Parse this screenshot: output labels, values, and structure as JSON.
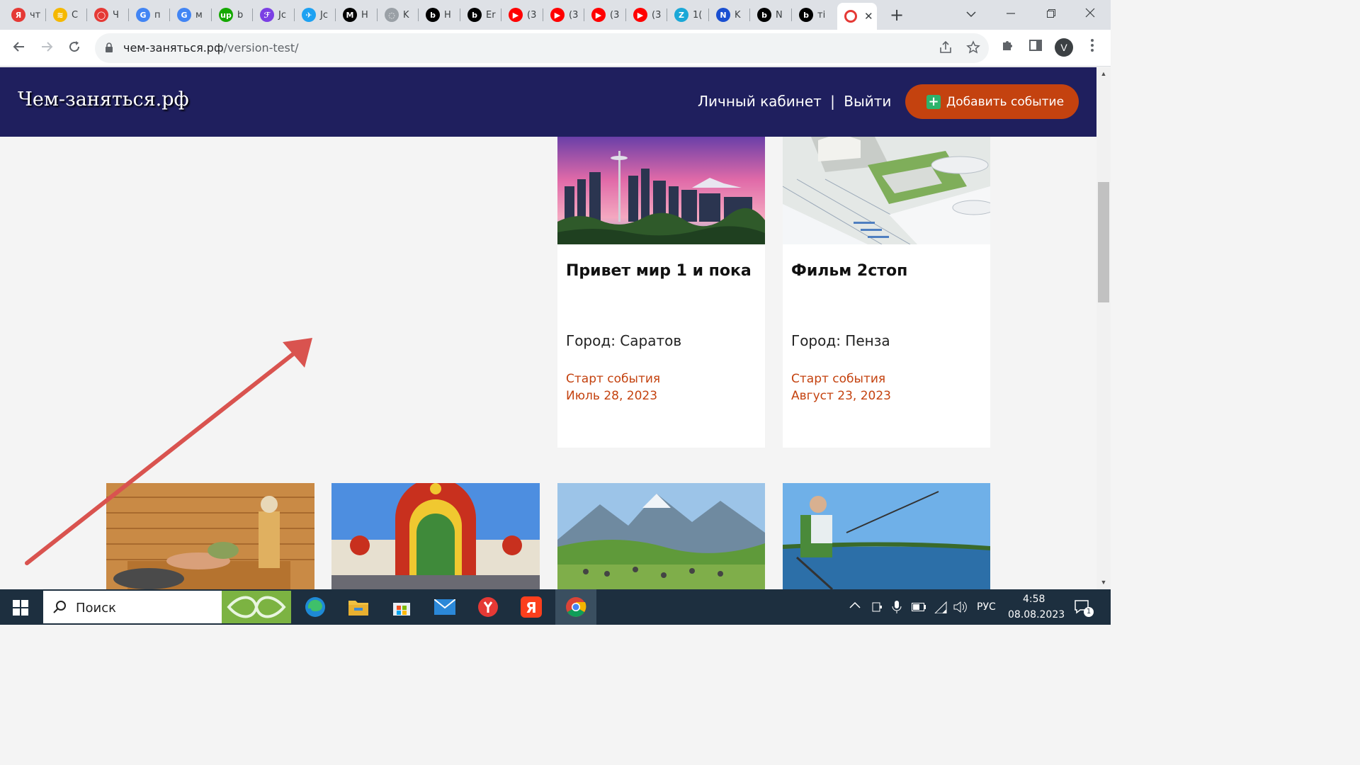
{
  "browser": {
    "tabs": [
      {
        "fav": "Я",
        "color": "#e53935",
        "title": "чт"
      },
      {
        "fav": "≋",
        "color": "#f5b800",
        "title": "С"
      },
      {
        "fav": "◯",
        "color": "#e53935",
        "title": "Ч"
      },
      {
        "fav": "G",
        "color": "#4285f4",
        "title": "п"
      },
      {
        "fav": "G",
        "color": "#4285f4",
        "title": "м"
      },
      {
        "fav": "up",
        "color": "#14a800",
        "title": "b"
      },
      {
        "fav": "ℱ",
        "color": "#7b3fe4",
        "title": "Jc"
      },
      {
        "fav": "✈",
        "color": "#1da1f2",
        "title": "Jc"
      },
      {
        "fav": "M",
        "color": "#000000",
        "title": "H"
      },
      {
        "fav": "◌",
        "color": "#9aa0a6",
        "title": "K"
      },
      {
        "fav": "b",
        "color": "#000000",
        "title": "H"
      },
      {
        "fav": "b",
        "color": "#000000",
        "title": "Er"
      },
      {
        "fav": "▶",
        "color": "#ff0000",
        "title": "(3"
      },
      {
        "fav": "▶",
        "color": "#ff0000",
        "title": "(3"
      },
      {
        "fav": "▶",
        "color": "#ff0000",
        "title": "(3"
      },
      {
        "fav": "▶",
        "color": "#ff0000",
        "title": "(3"
      },
      {
        "fav": "Z",
        "color": "#1ba8d7",
        "title": "1("
      },
      {
        "fav": "N",
        "color": "#1a4fd1",
        "title": "K"
      },
      {
        "fav": "b",
        "color": "#000000",
        "title": "N"
      },
      {
        "fav": "b",
        "color": "#000000",
        "title": "ті"
      }
    ],
    "active_tab": {
      "fav": "◯",
      "color": "#e53935",
      "close": "✕"
    },
    "new_tab": "+",
    "url_host": "чем-заняться.рф",
    "url_path": "/version-test/",
    "profile_initial": "V"
  },
  "site": {
    "logo": "Чем-заняться.рф",
    "nav": {
      "cabinet": "Личный кабинет",
      "separator": "|",
      "logout": "Выйти"
    },
    "add_button": "Добавить событие",
    "add_icon": "+",
    "cards": [
      {
        "title": "Привет мир 1 и пока",
        "city": "Город: Саратов",
        "start_label": "Старт события",
        "start_date": "Июль 28, 2023"
      },
      {
        "title": "Фильм 2стоп",
        "city": "Город: Пенза",
        "start_label": "Старт события",
        "start_date": "Август 23, 2023"
      }
    ],
    "arrow_color": "#d9534f"
  },
  "taskbar": {
    "search_label": "Поиск",
    "language": "РУС",
    "time": "4:58",
    "date": "08.08.2023",
    "notifications": "1"
  }
}
